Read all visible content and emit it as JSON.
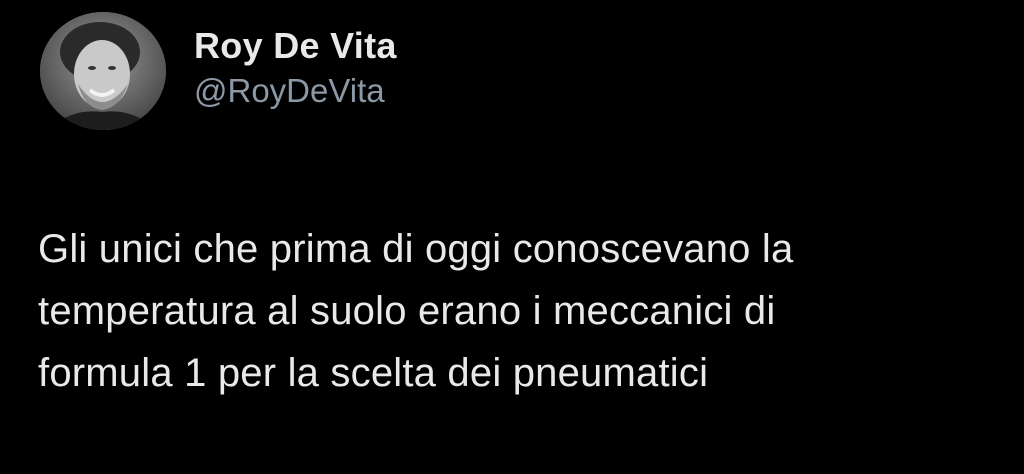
{
  "author": {
    "display_name": "Roy De Vita",
    "handle": "@RoyDeVita",
    "avatar_icon": "profile-photo"
  },
  "tweet": {
    "lines": [
      "Gli unici che prima di oggi conoscevano la",
      "temperatura al suolo erano i meccanici di",
      "formula 1 per la scelta dei pneumatici"
    ]
  },
  "colors": {
    "background": "#000000",
    "primary_text": "#e7e9ea",
    "secondary_text": "#8b98a5"
  }
}
